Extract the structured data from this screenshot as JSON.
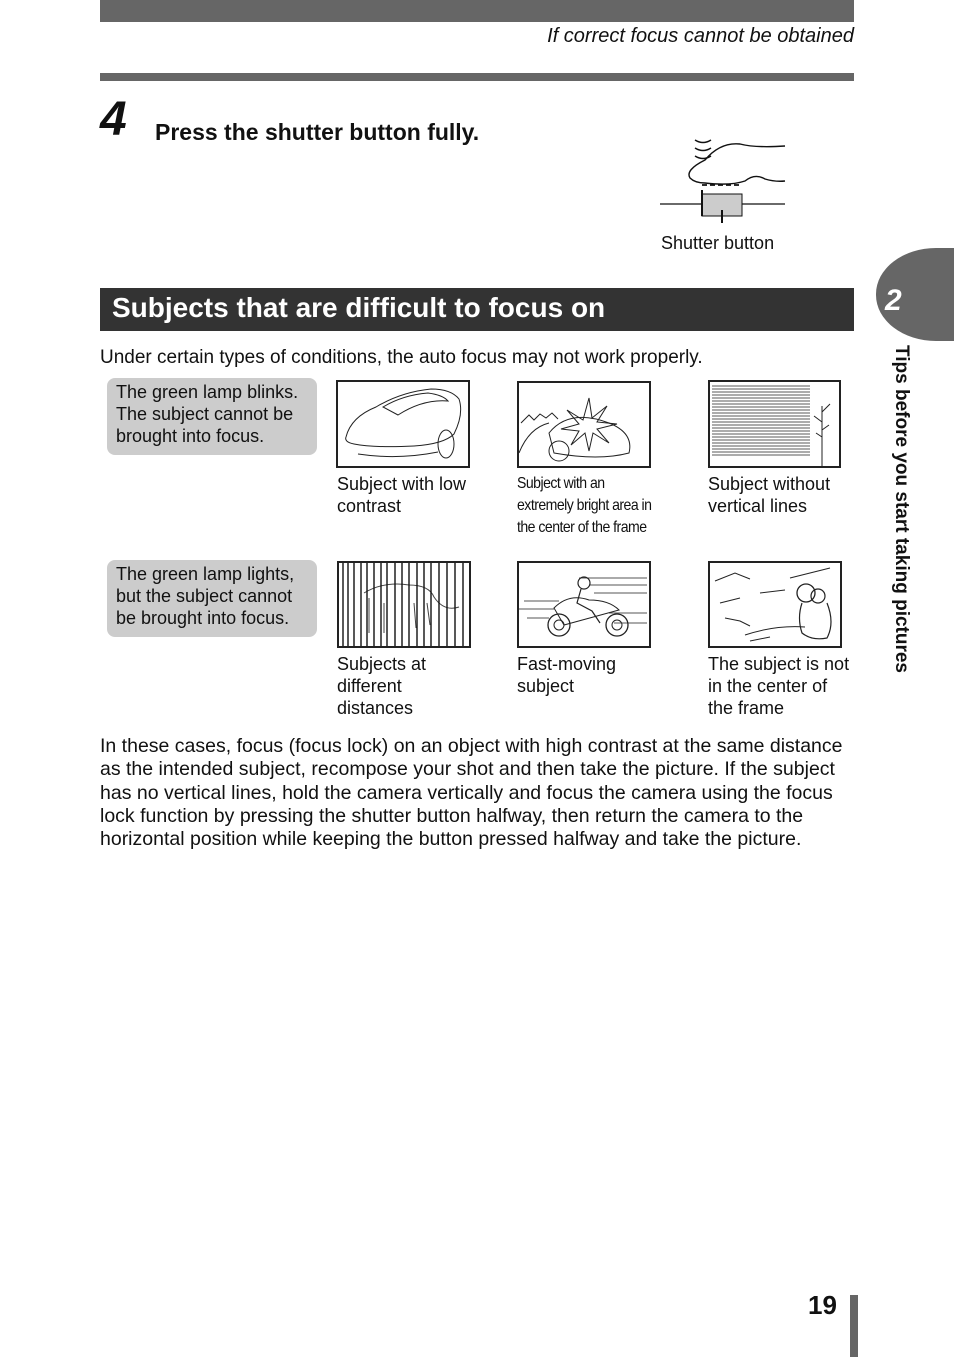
{
  "header": {
    "running_head": "If correct focus cannot be obtained"
  },
  "step": {
    "number": "4",
    "instruction": "Press the shutter button fully.",
    "figure_caption": "Shutter button"
  },
  "section": {
    "title": "Subjects that are difficult to focus on",
    "intro": "Under certain types of conditions, the auto focus may not work properly."
  },
  "groups": [
    {
      "note": "The green lamp blinks. The subject cannot be brought into focus.",
      "examples": [
        {
          "icon": "car-illustration",
          "caption": "Subject with low contrast"
        },
        {
          "icon": "bright-center-illustration",
          "caption": "Subject with an extremely bright area in the center of the frame"
        },
        {
          "icon": "horizontal-blinds-illustration",
          "caption": "Subject without vertical lines"
        }
      ]
    },
    {
      "note": "The green lamp lights, but the subject cannot be brought into focus.",
      "examples": [
        {
          "icon": "tiger-behind-bars-illustration",
          "caption": "Subjects at different distances"
        },
        {
          "icon": "motorcycle-illustration",
          "caption": "Fast-moving subject"
        },
        {
          "icon": "off-center-person-illustration",
          "caption": "The subject is not in the center of the frame"
        }
      ]
    }
  ],
  "body": "In these cases, focus (focus lock) on an object with high contrast at the same distance as the intended subject, recompose your shot and then take the picture. If the subject has no vertical lines, hold the camera vertically and focus the camera using the focus lock function by pressing the shutter button halfway, then return the camera to the horizontal position while keeping the button pressed halfway and take the picture.",
  "chapter": {
    "number": "2",
    "label": "Tips before you start taking pictures"
  },
  "footer": {
    "page_number": "19"
  },
  "colors": {
    "bar_gray": "#666666",
    "title_bar": "#333333",
    "note_bg": "#cccccc"
  }
}
